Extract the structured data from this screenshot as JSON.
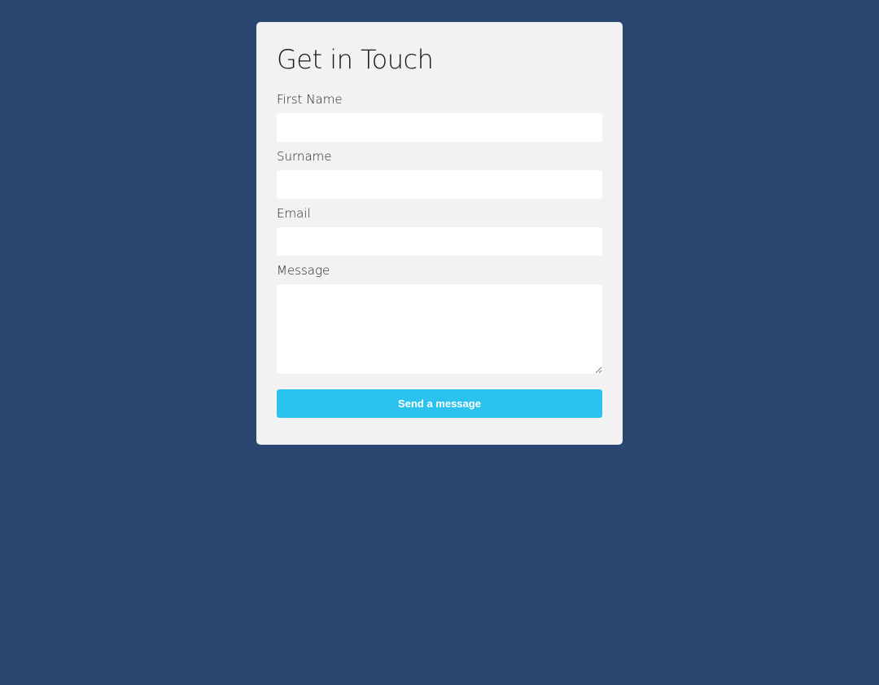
{
  "form": {
    "title": "Get in Touch",
    "fields": [
      {
        "label": "First Name",
        "value": "",
        "placeholder": ""
      },
      {
        "label": "Surname",
        "value": "",
        "placeholder": ""
      },
      {
        "label": "Email",
        "value": "",
        "placeholder": ""
      },
      {
        "label": "Message",
        "value": "",
        "placeholder": ""
      }
    ],
    "submit_label": "Send a message"
  },
  "colors": {
    "page_background": "#2b4670",
    "card_background": "#f2f2f2",
    "button_background": "#2cc2f0",
    "button_text": "#ffffff"
  }
}
